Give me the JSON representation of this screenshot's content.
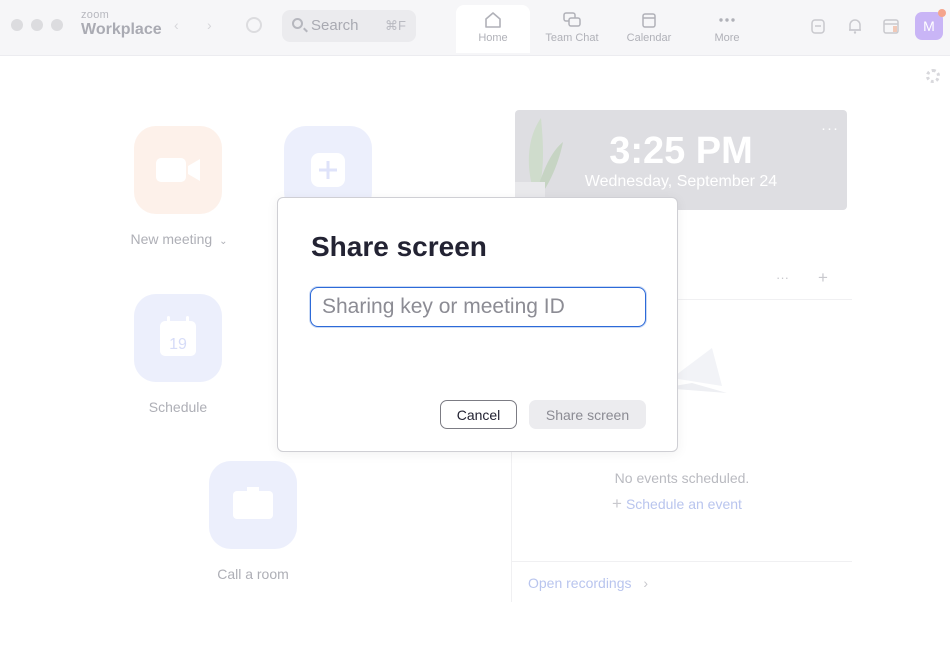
{
  "app": {
    "brand_small": "zoom",
    "brand_large": "Workplace"
  },
  "search": {
    "label": "Search",
    "shortcut": "⌘F"
  },
  "nav": {
    "tabs": [
      {
        "label": "Home",
        "icon": "home-icon",
        "active": true
      },
      {
        "label": "Team Chat",
        "icon": "chat-icon",
        "active": false
      },
      {
        "label": "Calendar",
        "icon": "calendar-icon",
        "active": false
      },
      {
        "label": "More",
        "icon": "more-icon",
        "active": false
      }
    ]
  },
  "user": {
    "initial": "M",
    "avatar_color": "#c9b5f6"
  },
  "home": {
    "tiles": [
      {
        "label": "New meeting",
        "icon": "video-camera-icon",
        "color": "#fdf1ea",
        "has_dropdown": true
      },
      {
        "label": "",
        "icon": "plus-icon",
        "color": "#eceffc"
      },
      {
        "label": "Schedule",
        "icon": "calendar-icon",
        "color": "#eceffc",
        "date_number": "19"
      },
      {
        "label": "Call a room",
        "icon": "monitor-icon",
        "color": "#eceffc"
      }
    ]
  },
  "clock": {
    "time": "3:25 PM",
    "date": "Wednesday, September 24",
    "menu": "···"
  },
  "events": {
    "header_menu": "···",
    "header_add": "+",
    "empty_text": "No events scheduled.",
    "schedule_link": "Schedule an event",
    "recordings_link": "Open recordings"
  },
  "modal": {
    "title": "Share screen",
    "input_placeholder": "Sharing key or meeting ID",
    "input_value": "",
    "cancel_label": "Cancel",
    "share_label": "Share screen",
    "accent_color": "#2d6ad8"
  }
}
